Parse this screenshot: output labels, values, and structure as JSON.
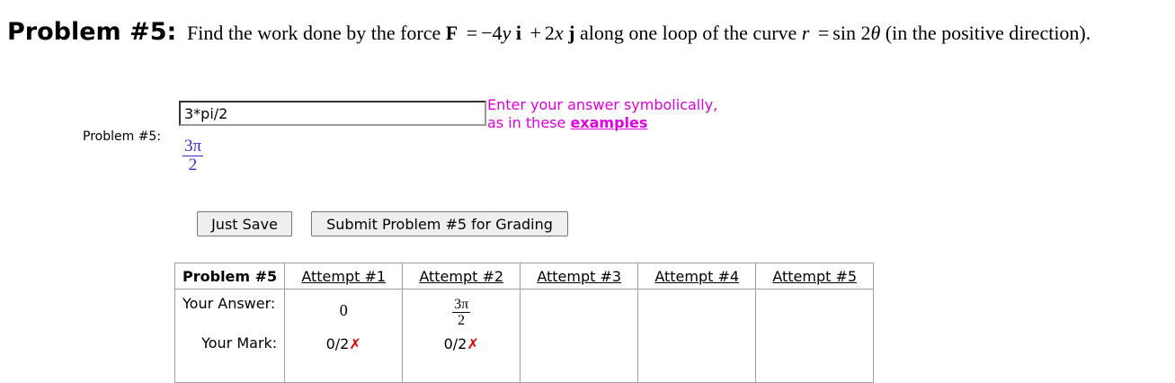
{
  "problem": {
    "title": "Problem #5:",
    "statement": {
      "lead": "Find the work done by the force",
      "vec_F": "F",
      "eq": "=",
      "term1": "−4",
      "var_y": "y",
      "unit_i": "i",
      "plus": "+",
      "term2": "2",
      "var_x": "x",
      "unit_j": "j",
      "mid": "along one loop of the curve",
      "var_r": "r",
      "eq2": "=",
      "func": "sin 2",
      "theta": "θ",
      "tail": "(in the positive direction)."
    },
    "side_label": "Problem #5:"
  },
  "answer": {
    "value": "3*pi/2",
    "preview_num": "3π",
    "preview_den": "2"
  },
  "hint": {
    "line1": "Enter your answer symbolically,",
    "line2_prefix": "as in these",
    "link": "examples"
  },
  "buttons": {
    "save": "Just Save",
    "submit": "Submit Problem #5 for Grading"
  },
  "attempts_table": {
    "header_first": "Problem #5",
    "headers": [
      "Attempt #1",
      "Attempt #2",
      "Attempt #3",
      "Attempt #4",
      "Attempt #5"
    ],
    "answer_label": "Your Answer:",
    "mark_label": "Your Mark:",
    "answers": {
      "a1": "0",
      "a2_num": "3π",
      "a2_den": "2"
    },
    "marks": {
      "m1": "0/2",
      "m2": "0/2"
    },
    "wrong_symbol": "✗"
  }
}
